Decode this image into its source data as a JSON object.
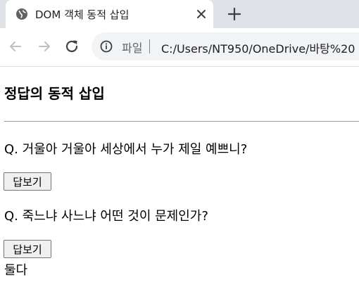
{
  "browser": {
    "tab_title": "DOM 객체 동적 삽입",
    "scheme_chip": "파일",
    "url": "C:/Users/NT950/OneDrive/바탕%20"
  },
  "page": {
    "heading": "정답의 동적 삽입",
    "questions": [
      {
        "text": "Q. 거울아 거울아 세상에서 누가 제일 예쁘니?",
        "button_label": "답보기"
      },
      {
        "text": "Q. 죽느냐 사느냐 어떤 것이 문제인가?",
        "button_label": "답보기",
        "answer": "둘다"
      }
    ]
  },
  "icons": {
    "favicon": "globe-icon",
    "tab_close": "close-icon",
    "new_tab": "plus-icon",
    "back": "arrow-left-icon",
    "forward": "arrow-right-icon",
    "reload": "reload-icon",
    "site_info": "info-icon"
  }
}
